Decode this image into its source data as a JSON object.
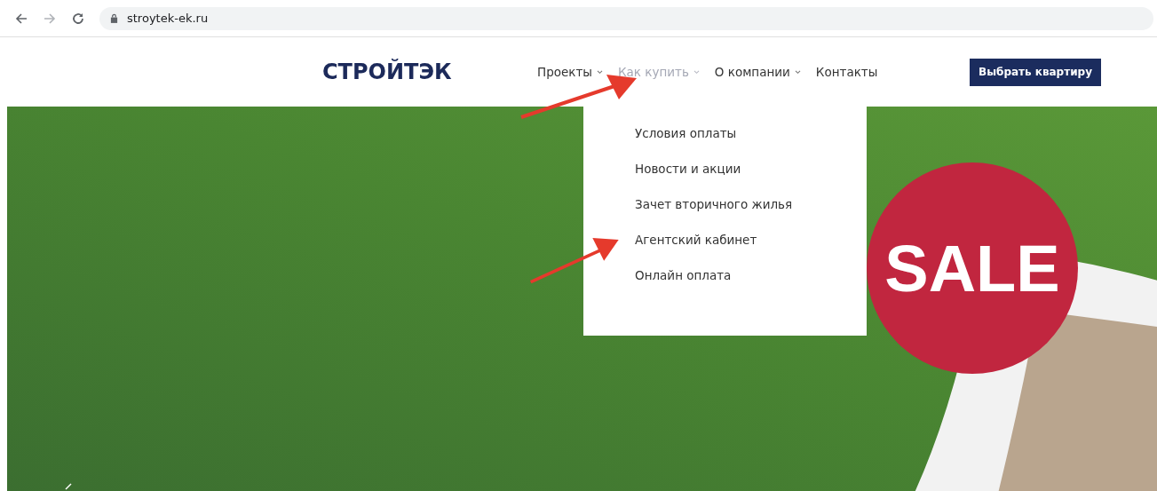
{
  "browser": {
    "url": "stroytek-ek.ru"
  },
  "header": {
    "logo": "СТРОЙТЭК",
    "nav": [
      {
        "label": "Проекты",
        "kind": "dropdown",
        "selected": false
      },
      {
        "label": "Как купить",
        "kind": "dropdown",
        "selected": true,
        "menu": [
          "Условия оплаты",
          "Новости и акции",
          "Зачет вторичного жилья",
          "Агентский кабинет",
          "Онлайн оплата"
        ]
      },
      {
        "label": "О компании",
        "kind": "dropdown",
        "selected": false
      },
      {
        "label": "Контакты",
        "kind": "link",
        "selected": false
      }
    ],
    "cta_button": "Выбрать квартиру"
  },
  "hero": {
    "badge": "SALE"
  }
}
